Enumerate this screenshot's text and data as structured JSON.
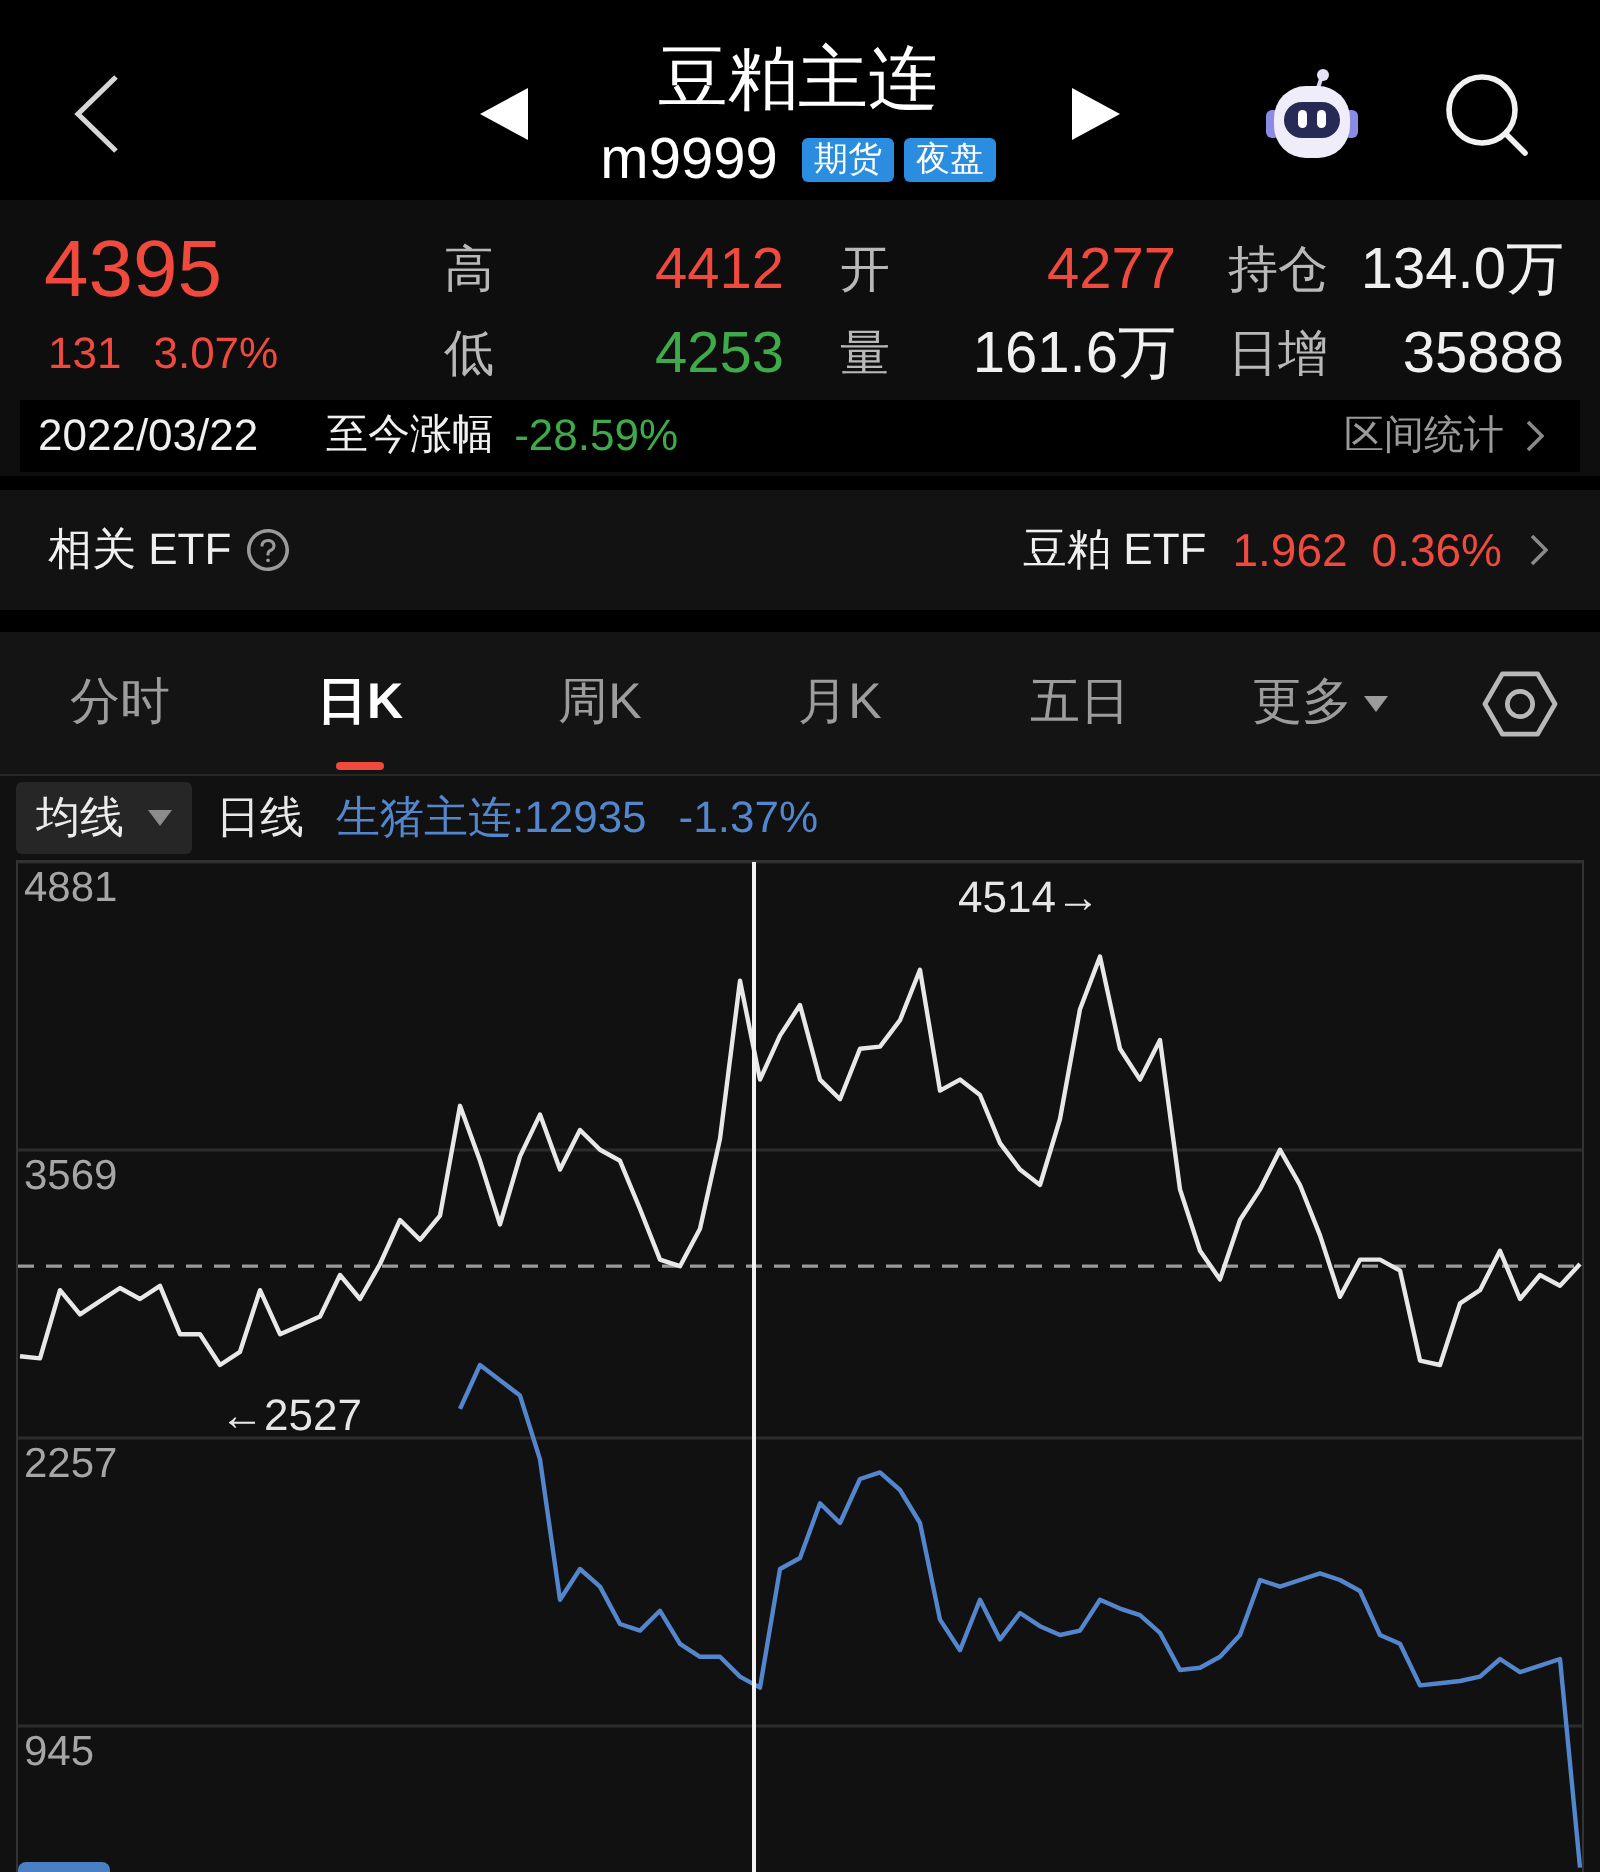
{
  "header": {
    "title": "豆粕主连",
    "code": "m9999",
    "badges": [
      "期货",
      "夜盘"
    ]
  },
  "quote": {
    "price": "4395",
    "change": "131",
    "change_pct": "3.07%",
    "color": "#f0493e",
    "stats": [
      {
        "label": "高",
        "value": "4412",
        "color": "#f0493e"
      },
      {
        "label": "开",
        "value": "4277",
        "color": "#f0493e"
      },
      {
        "label": "持仓",
        "value": "134.0万",
        "color": "#f0f0f0"
      },
      {
        "label": "低",
        "value": "4253",
        "color": "#3eab4b"
      },
      {
        "label": "量",
        "value": "161.6万",
        "color": "#f0f0f0"
      },
      {
        "label": "日增",
        "value": "35888",
        "color": "#f0f0f0"
      }
    ]
  },
  "since_date": {
    "date": "2022/03/22",
    "label": "至今涨幅",
    "change": "-28.59%",
    "color": "#3eab4b",
    "link": "区间统计"
  },
  "related_etf": {
    "label": "相关 ETF",
    "name": "豆粕 ETF",
    "price": "1.962",
    "change": "0.36%",
    "color": "#f0493e"
  },
  "tabs": [
    {
      "label": "分时",
      "selected": false,
      "dropdown": false
    },
    {
      "label": "日K",
      "selected": true,
      "dropdown": false
    },
    {
      "label": "周K",
      "selected": false,
      "dropdown": false
    },
    {
      "label": "月K",
      "selected": false,
      "dropdown": false
    },
    {
      "label": "五日",
      "selected": false,
      "dropdown": false
    },
    {
      "label": "更多",
      "selected": false,
      "dropdown": true
    }
  ],
  "legend": {
    "dropdown": "均线",
    "change": "-1.37%"
  },
  "chart_data": {
    "type": "line",
    "ylim": [
      280,
      4881
    ],
    "yticks": [
      945,
      2257,
      3569,
      4881
    ],
    "grid": true,
    "series": [
      {
        "name": "日线",
        "color": "#e8e8e8",
        "values": [
          2630,
          2620,
          2930,
          2820,
          2880,
          2940,
          2890,
          2950,
          2730,
          2730,
          2590,
          2650,
          2930,
          2730,
          2770,
          2810,
          3000,
          2890,
          3050,
          3250,
          3160,
          3270,
          3770,
          3520,
          3230,
          3540,
          3730,
          3480,
          3660,
          3570,
          3520,
          3300,
          3070,
          3040,
          3210,
          3620,
          4340,
          3890,
          4090,
          4230,
          3890,
          3800,
          4030,
          4040,
          4160,
          4390,
          3840,
          3890,
          3820,
          3600,
          3480,
          3410,
          3710,
          4210,
          4450,
          4030,
          3890,
          4070,
          3390,
          3110,
          2980,
          3250,
          3390,
          3570,
          3410,
          3180,
          2900,
          3070,
          3070,
          3020,
          2610,
          2590,
          2870,
          2930,
          3110,
          2890,
          3000,
          2950,
          3050
        ]
      },
      {
        "name": "生猪主连:12935",
        "color": "#5386cc",
        "values": [
          null,
          null,
          null,
          null,
          null,
          null,
          null,
          null,
          null,
          null,
          null,
          null,
          null,
          null,
          null,
          null,
          null,
          null,
          null,
          null,
          null,
          null,
          2390,
          2590,
          2520,
          2450,
          2160,
          1520,
          1660,
          1580,
          1410,
          1380,
          1470,
          1320,
          1260,
          1260,
          1170,
          1120,
          1660,
          1710,
          1960,
          1870,
          2070,
          2100,
          2020,
          1870,
          1430,
          1290,
          1520,
          1340,
          1460,
          1400,
          1360,
          1380,
          1520,
          1480,
          1450,
          1370,
          1200,
          1210,
          1260,
          1360,
          1610,
          1580,
          1610,
          1640,
          1610,
          1560,
          1360,
          1320,
          1130,
          1140,
          1150,
          1170,
          1250,
          1190,
          1220,
          1250,
          300
        ]
      }
    ],
    "ref_lines": [
      {
        "axis": "y",
        "value": 3040
      }
    ],
    "annotations": [
      "4514→",
      "←2527"
    ]
  }
}
